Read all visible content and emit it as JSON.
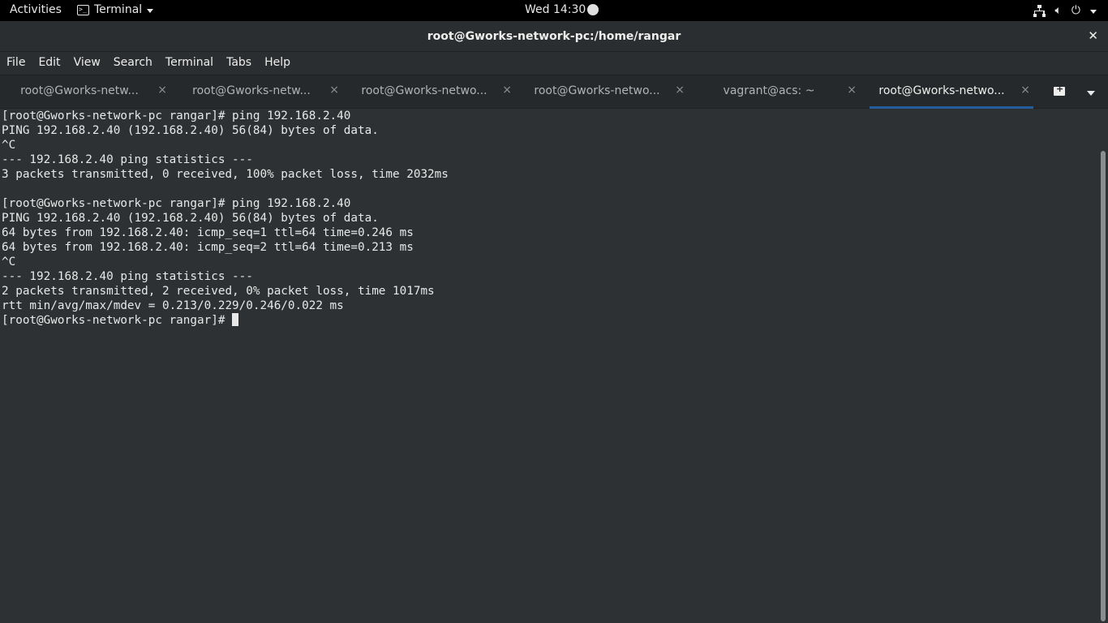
{
  "topbar": {
    "activities": "Activities",
    "app_name": "Terminal",
    "clock": "Wed 14:30",
    "status_icons": [
      "network-icon",
      "volume-icon",
      "power-icon"
    ]
  },
  "window": {
    "title": "root@Gworks-network-pc:/home/rangar",
    "close_glyph": "✕"
  },
  "menubar": {
    "items": [
      "File",
      "Edit",
      "View",
      "Search",
      "Terminal",
      "Tabs",
      "Help"
    ]
  },
  "tabs": [
    {
      "label": "root@Gworks-netw...",
      "active": false
    },
    {
      "label": "root@Gworks-netw...",
      "active": false
    },
    {
      "label": "root@Gworks-netwo...",
      "active": false
    },
    {
      "label": "root@Gworks-netwo...",
      "active": false
    },
    {
      "label": "vagrant@acs: ~",
      "active": false
    },
    {
      "label": "root@Gworks-netwo...",
      "active": true
    }
  ],
  "tab_close_glyph": "×",
  "terminal": {
    "lines": [
      "[root@Gworks-network-pc rangar]# ping 192.168.2.40",
      "PING 192.168.2.40 (192.168.2.40) 56(84) bytes of data.",
      "^C",
      "--- 192.168.2.40 ping statistics ---",
      "3 packets transmitted, 0 received, 100% packet loss, time 2032ms",
      "",
      "[root@Gworks-network-pc rangar]# ping 192.168.2.40",
      "PING 192.168.2.40 (192.168.2.40) 56(84) bytes of data.",
      "64 bytes from 192.168.2.40: icmp_seq=1 ttl=64 time=0.246 ms",
      "64 bytes from 192.168.2.40: icmp_seq=2 ttl=64 time=0.213 ms",
      "^C",
      "--- 192.168.2.40 ping statistics ---",
      "2 packets transmitted, 2 received, 0% packet loss, time 1017ms",
      "rtt min/avg/max/mdev = 0.213/0.229/0.246/0.022 ms"
    ],
    "prompt": "[root@Gworks-network-pc rangar]# "
  },
  "colors": {
    "terminal_bg": "#2d3133",
    "terminal_fg": "#e8e8e8",
    "active_tab_accent": "#215d9c"
  }
}
